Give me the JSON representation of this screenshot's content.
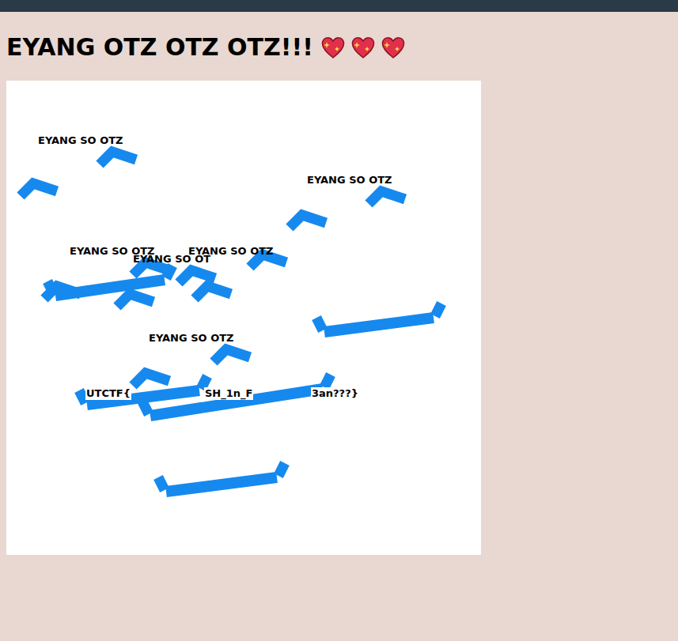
{
  "page": {
    "heading": "EYANG OTZ OTZ OTZ!!!",
    "hearts": 3
  },
  "canvas": {
    "labels": [
      "EYANG SO OTZ",
      "EYANG SO OTZ",
      "EYANG SO OTZ",
      "EYANG SO OT",
      "EYANG SO OTZ",
      "EYANG SO OTZ"
    ],
    "flag_fragments": [
      "UTCTF{",
      "SH_1n_F",
      "3an???}"
    ]
  }
}
